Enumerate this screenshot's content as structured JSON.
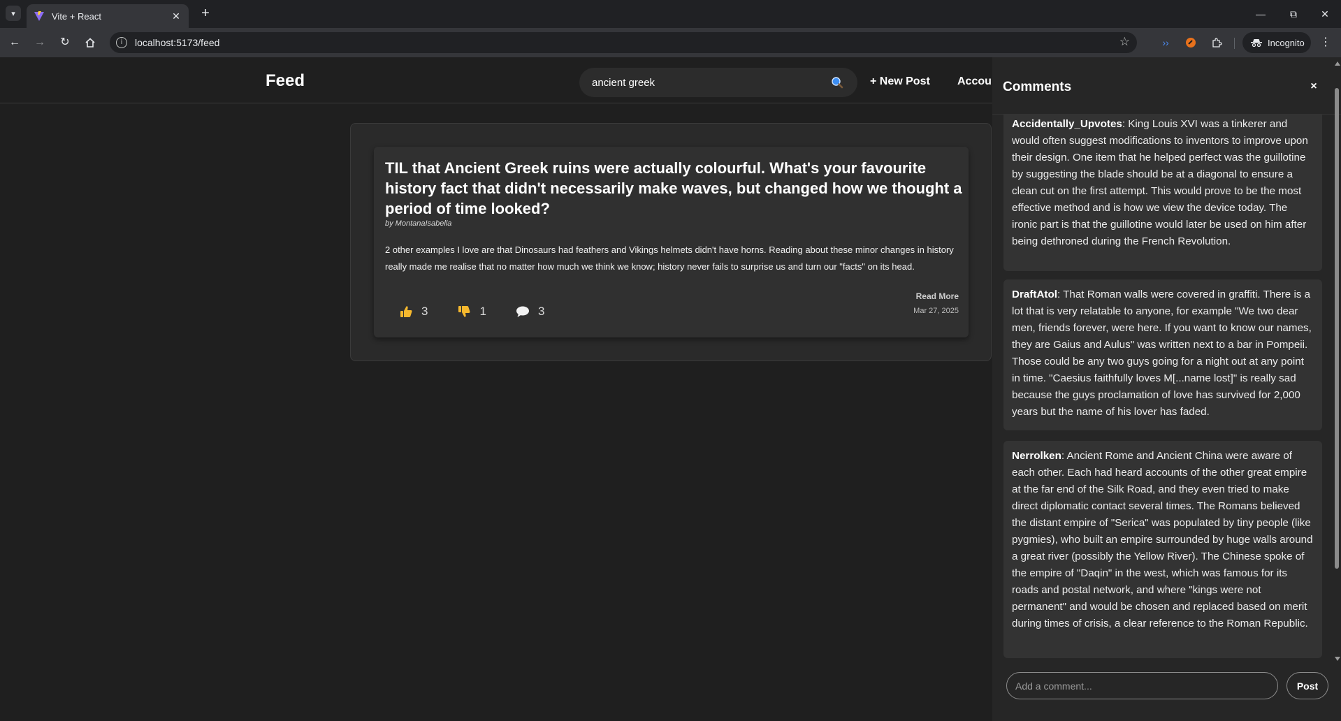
{
  "browser": {
    "tab_title": "Vite + React",
    "url": "localhost:5173/feed",
    "profile_label": "Incognito"
  },
  "icons": {
    "tab_menu": "chevron-down-icon",
    "back": "arrow-left-icon",
    "forward": "arrow-right-icon",
    "reload": "reload-icon",
    "home": "home-icon",
    "site_info": "info-icon",
    "bookmark": "star-icon",
    "extensions": "puzzle-icon",
    "search": "magnifier-icon",
    "like": "thumbs-up-icon",
    "dislike": "thumbs-down-icon",
    "comments": "speech-bubble-icon"
  },
  "colors": {
    "background": "#1f1f1f",
    "card": "#303030",
    "sidebar": "#262626",
    "emoji_yellow": "#f5b82e"
  },
  "header": {
    "title": "Feed",
    "search_value": "ancient greek",
    "new_post_label": "+ New Post",
    "account_label": "Accour"
  },
  "post": {
    "title": "TIL that Ancient Greek ruins were actually colourful. What's your favourite history fact that didn't necessarily make waves, but changed how we thought a period of time looked?",
    "author": "by MontanaIsabella",
    "body": "2 other examples I love are that Dinosaurs had feathers and Vikings helmets didn't have horns. Reading about these minor changes in history really made me realise that no matter how much we think we know; history never fails to surprise us and turn our \"facts\" on its head.",
    "likes": "3",
    "dislikes": "1",
    "comment_count": "3",
    "read_more": "Read More",
    "date": "Mar 27, 2025"
  },
  "comments_panel": {
    "title": "Comments",
    "close": "×",
    "items": [
      {
        "author": "Accidentally_Upvotes",
        "text": ": King Louis XVI was a tinkerer and would often suggest modifications to inventors to improve upon their design. One item that he helped perfect was the guillotine by suggesting the blade should be at a diagonal to ensure a clean cut on the first attempt. This would prove to be the most effective method and is how we view the device today. The ironic part is that the guillotine would later be used on him after being dethroned during the French Revolution."
      },
      {
        "author": "DraftAtol",
        "text": ": That Roman walls were covered in graffiti. There is a lot that is very relatable to anyone, for example \"We two dear men, friends forever, were here. If you want to know our names, they are Gaius and Aulus\" was written next to a bar in Pompeii. Those could be any two guys going for a night out at any point in time. \"Caesius faithfully loves M[...name lost]\" is really sad because the guys proclamation of love has survived for 2,000 years but the name of his lover has faded."
      },
      {
        "author": "Nerrolken",
        "text": ": Ancient Rome and Ancient China were aware of each other. Each had heard accounts of the other great empire at the far end of the Silk Road, and they even tried to make direct diplomatic contact several times. The Romans believed the distant empire of \"Serica\" was populated by tiny people (like pygmies), who built an empire surrounded by huge walls around a great river (possibly the Yellow River). The Chinese spoke of the empire of \"Daqin\" in the west, which was famous for its roads and postal network, and where \"kings were not permanent\" and would be chosen and replaced based on merit during times of crisis, a clear reference to the Roman Republic."
      }
    ],
    "input_placeholder": "Add a comment...",
    "post_button": "Post"
  }
}
